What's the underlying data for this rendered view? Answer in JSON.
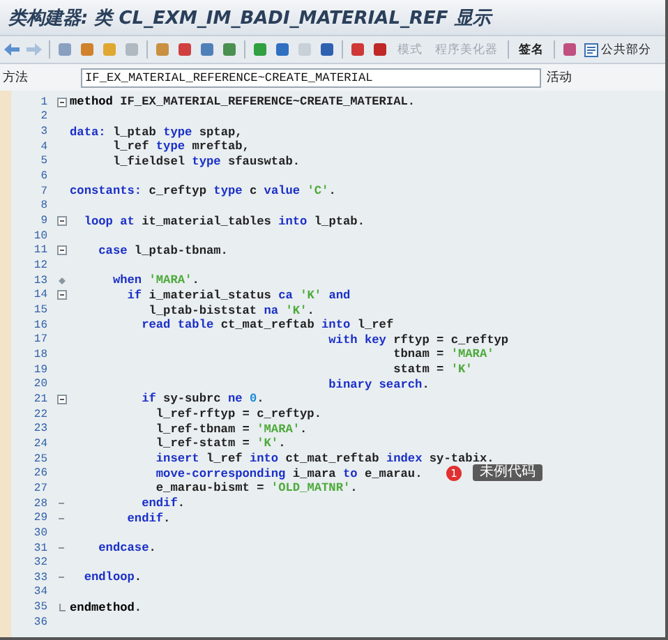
{
  "window": {
    "title": "类构建器: 类 CL_EXM_IM_BADI_MATERIAL_REF 显示"
  },
  "toolbar": {
    "buttons": [
      {
        "label": "模式",
        "disabled": true
      },
      {
        "label": "程序美化器",
        "disabled": true
      },
      {
        "label": "签名",
        "disabled": false
      }
    ],
    "public_section": {
      "label": "公共部分"
    }
  },
  "method_field": {
    "label": "方法",
    "value": "IF_EX_MATERIAL_REFERENCE~CREATE_MATERIAL",
    "status": "活动"
  },
  "editor": {
    "lines": [
      {
        "number": "1",
        "kind": "open",
        "tokens": [
          {
            "text": "method",
            "kind": "bold"
          },
          {
            "text": " IF_EX_MATERIAL_REFERENCE~CREATE_MATERIAL.",
            "kind": "plain"
          }
        ]
      },
      {
        "number": "2",
        "kind": "plain"
      },
      {
        "number": "3",
        "kind": "plain",
        "tokens": [
          {
            "text": "data:",
            "kind": "keyword"
          },
          {
            "text": " l_ptab ",
            "kind": "plain"
          },
          {
            "text": "type",
            "kind": "keyword"
          },
          {
            "text": " sptap,",
            "kind": "plain"
          }
        ]
      },
      {
        "number": "4",
        "kind": "plain",
        "tokens": [
          {
            "text": "      l_ref ",
            "kind": "plain"
          },
          {
            "text": "type",
            "kind": "keyword"
          },
          {
            "text": " mreftab,",
            "kind": "plain"
          }
        ]
      },
      {
        "number": "5",
        "kind": "plain",
        "tokens": [
          {
            "text": "      l_fieldsel ",
            "kind": "plain"
          },
          {
            "text": "type",
            "kind": "keyword"
          },
          {
            "text": " sfauswtab.",
            "kind": "plain"
          }
        ]
      },
      {
        "number": "6",
        "kind": "plain"
      },
      {
        "number": "7",
        "kind": "plain",
        "tokens": [
          {
            "text": "constants:",
            "kind": "keyword"
          },
          {
            "text": " c_reftyp ",
            "kind": "plain"
          },
          {
            "text": "type",
            "kind": "keyword"
          },
          {
            "text": " c ",
            "kind": "plain"
          },
          {
            "text": "value",
            "kind": "keyword"
          },
          {
            "text": " 'C'",
            "kind": "string"
          },
          {
            "text": ".",
            "kind": "plain"
          }
        ]
      },
      {
        "number": "8",
        "kind": "plain"
      },
      {
        "number": "9",
        "kind": "open",
        "tokens": [
          {
            "text": "  loop at",
            "kind": "keyword"
          },
          {
            "text": " it_material_tables ",
            "kind": "plain"
          },
          {
            "text": "into",
            "kind": "keyword"
          },
          {
            "text": " l_ptab.",
            "kind": "plain"
          }
        ]
      },
      {
        "number": "10",
        "kind": "plain"
      },
      {
        "number": "11",
        "kind": "open",
        "tokens": [
          {
            "text": "    case",
            "kind": "keyword"
          },
          {
            "text": " l_ptab-tbnam.",
            "kind": "plain"
          }
        ]
      },
      {
        "number": "12",
        "kind": "plain"
      },
      {
        "number": "13",
        "kind": "branch",
        "tokens": [
          {
            "text": "      when",
            "kind": "keyword"
          },
          {
            "text": " 'MARA'",
            "kind": "string"
          },
          {
            "text": ".",
            "kind": "plain"
          }
        ]
      },
      {
        "number": "14",
        "kind": "open",
        "tokens": [
          {
            "text": "        if",
            "kind": "keyword"
          },
          {
            "text": " i_material_status ",
            "kind": "plain"
          },
          {
            "text": "ca",
            "kind": "keyword"
          },
          {
            "text": " 'K' ",
            "kind": "string"
          },
          {
            "text": "and",
            "kind": "keyword"
          }
        ]
      },
      {
        "number": "15",
        "kind": "plain",
        "tokens": [
          {
            "text": "           l_ptab-biststat ",
            "kind": "plain"
          },
          {
            "text": "na",
            "kind": "keyword"
          },
          {
            "text": " 'K'",
            "kind": "string"
          },
          {
            "text": ".",
            "kind": "plain"
          }
        ]
      },
      {
        "number": "16",
        "kind": "plain",
        "tokens": [
          {
            "text": "          read table",
            "kind": "keyword"
          },
          {
            "text": " ct_mat_reftab ",
            "kind": "plain"
          },
          {
            "text": "into",
            "kind": "keyword"
          },
          {
            "text": " l_ref",
            "kind": "plain"
          }
        ]
      },
      {
        "number": "17",
        "kind": "plain",
        "tokens": [
          {
            "text": "                                    with key",
            "kind": "keyword"
          },
          {
            "text": " rftyp = c_reftyp",
            "kind": "plain"
          }
        ]
      },
      {
        "number": "18",
        "kind": "plain",
        "tokens": [
          {
            "text": "                                             tbnam = ",
            "kind": "plain"
          },
          {
            "text": "'MARA'",
            "kind": "string"
          }
        ]
      },
      {
        "number": "19",
        "kind": "plain",
        "tokens": [
          {
            "text": "                                             statm = ",
            "kind": "plain"
          },
          {
            "text": "'K'",
            "kind": "string"
          }
        ]
      },
      {
        "number": "20",
        "kind": "plain",
        "tokens": [
          {
            "text": "                                    binary search",
            "kind": "keyword"
          },
          {
            "text": ".",
            "kind": "plain"
          }
        ]
      },
      {
        "number": "21",
        "kind": "open",
        "tokens": [
          {
            "text": "          if",
            "kind": "keyword"
          },
          {
            "text": " sy-subrc ",
            "kind": "plain"
          },
          {
            "text": "ne",
            "kind": "keyword"
          },
          {
            "text": " 0",
            "kind": "number"
          },
          {
            "text": ".",
            "kind": "plain"
          }
        ]
      },
      {
        "number": "22",
        "kind": "plain",
        "tokens": [
          {
            "text": "            l_ref-rftyp = c_reftyp.",
            "kind": "plain"
          }
        ]
      },
      {
        "number": "23",
        "kind": "plain",
        "tokens": [
          {
            "text": "            l_ref-tbnam = ",
            "kind": "plain"
          },
          {
            "text": "'MARA'",
            "kind": "string"
          },
          {
            "text": ".",
            "kind": "plain"
          }
        ]
      },
      {
        "number": "24",
        "kind": "plain",
        "tokens": [
          {
            "text": "            l_ref-statm = ",
            "kind": "plain"
          },
          {
            "text": "'K'",
            "kind": "string"
          },
          {
            "text": ".",
            "kind": "plain"
          }
        ]
      },
      {
        "number": "25",
        "kind": "plain",
        "tokens": [
          {
            "text": "            insert",
            "kind": "keyword"
          },
          {
            "text": " l_ref ",
            "kind": "plain"
          },
          {
            "text": "into",
            "kind": "keyword"
          },
          {
            "text": " ct_mat_reftab ",
            "kind": "plain"
          },
          {
            "text": "index",
            "kind": "keyword"
          },
          {
            "text": " sy-tabix.",
            "kind": "plain"
          }
        ]
      },
      {
        "number": "26",
        "kind": "plain",
        "tokens": [
          {
            "text": "            move-corresponding",
            "kind": "keyword"
          },
          {
            "text": " i_mara ",
            "kind": "plain"
          },
          {
            "text": "to",
            "kind": "keyword"
          },
          {
            "text": " e_marau.",
            "kind": "plain"
          }
        ],
        "note": {
          "badge": "1",
          "text": "未例代码"
        }
      },
      {
        "number": "27",
        "kind": "plain",
        "tokens": [
          {
            "text": "            e_marau-bismt = ",
            "kind": "plain"
          },
          {
            "text": "'OLD_MATNR'",
            "kind": "string"
          },
          {
            "text": ".",
            "kind": "plain"
          }
        ]
      },
      {
        "number": "28",
        "kind": "close",
        "tokens": [
          {
            "text": "          endif",
            "kind": "keyword"
          },
          {
            "text": ".",
            "kind": "plain"
          }
        ]
      },
      {
        "number": "29",
        "kind": "close",
        "tokens": [
          {
            "text": "        endif",
            "kind": "keyword"
          },
          {
            "text": ".",
            "kind": "plain"
          }
        ]
      },
      {
        "number": "30",
        "kind": "plain"
      },
      {
        "number": "31",
        "kind": "close",
        "tokens": [
          {
            "text": "    endcase",
            "kind": "keyword"
          },
          {
            "text": ".",
            "kind": "plain"
          }
        ]
      },
      {
        "number": "32",
        "kind": "plain"
      },
      {
        "number": "33",
        "kind": "close",
        "tokens": [
          {
            "text": "  endloop",
            "kind": "keyword"
          },
          {
            "text": ".",
            "kind": "plain"
          }
        ]
      },
      {
        "number": "34",
        "kind": "plain"
      },
      {
        "number": "35",
        "kind": "end",
        "tokens": [
          {
            "text": "endmethod",
            "kind": "bold"
          },
          {
            "text": ".",
            "kind": "plain"
          }
        ]
      },
      {
        "number": "36",
        "kind": "plain"
      }
    ]
  }
}
